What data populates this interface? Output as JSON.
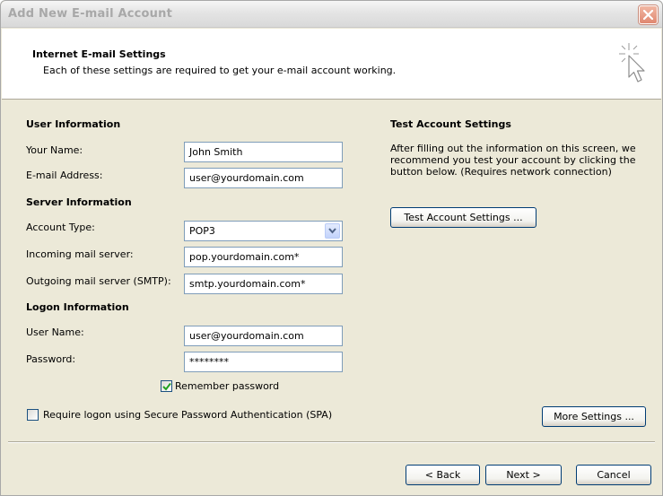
{
  "window": {
    "title": "Add New E-mail Account"
  },
  "header": {
    "title": "Internet E-mail Settings",
    "subtitle": "Each of these settings are required to get your e-mail account working."
  },
  "user_info": {
    "heading": "User Information",
    "name_label": "Your Name:",
    "name_value": "John Smith",
    "email_label": "E-mail Address:",
    "email_value": "user@yourdomain.com"
  },
  "server_info": {
    "heading": "Server Information",
    "account_type_label": "Account Type:",
    "account_type_value": "POP3",
    "incoming_label": "Incoming mail server:",
    "incoming_value": "pop.yourdomain.com*",
    "outgoing_label": "Outgoing mail server (SMTP):",
    "outgoing_value": "smtp.yourdomain.com*"
  },
  "logon_info": {
    "heading": "Logon Information",
    "username_label": "User Name:",
    "username_value": "user@yourdomain.com",
    "password_label": "Password:",
    "password_value": "********",
    "remember_label": "Remember password",
    "remember_checked": true,
    "spa_label": "Require logon using Secure Password Authentication (SPA)",
    "spa_checked": false
  },
  "test_settings": {
    "heading": "Test Account Settings",
    "description": "After filling out the information on this screen, we recommend you test your account by clicking the button below. (Requires network connection)",
    "button_label": "Test Account Settings ..."
  },
  "buttons": {
    "more_settings": "More Settings ...",
    "back": "< Back",
    "next": "Next >",
    "cancel": "Cancel"
  }
}
